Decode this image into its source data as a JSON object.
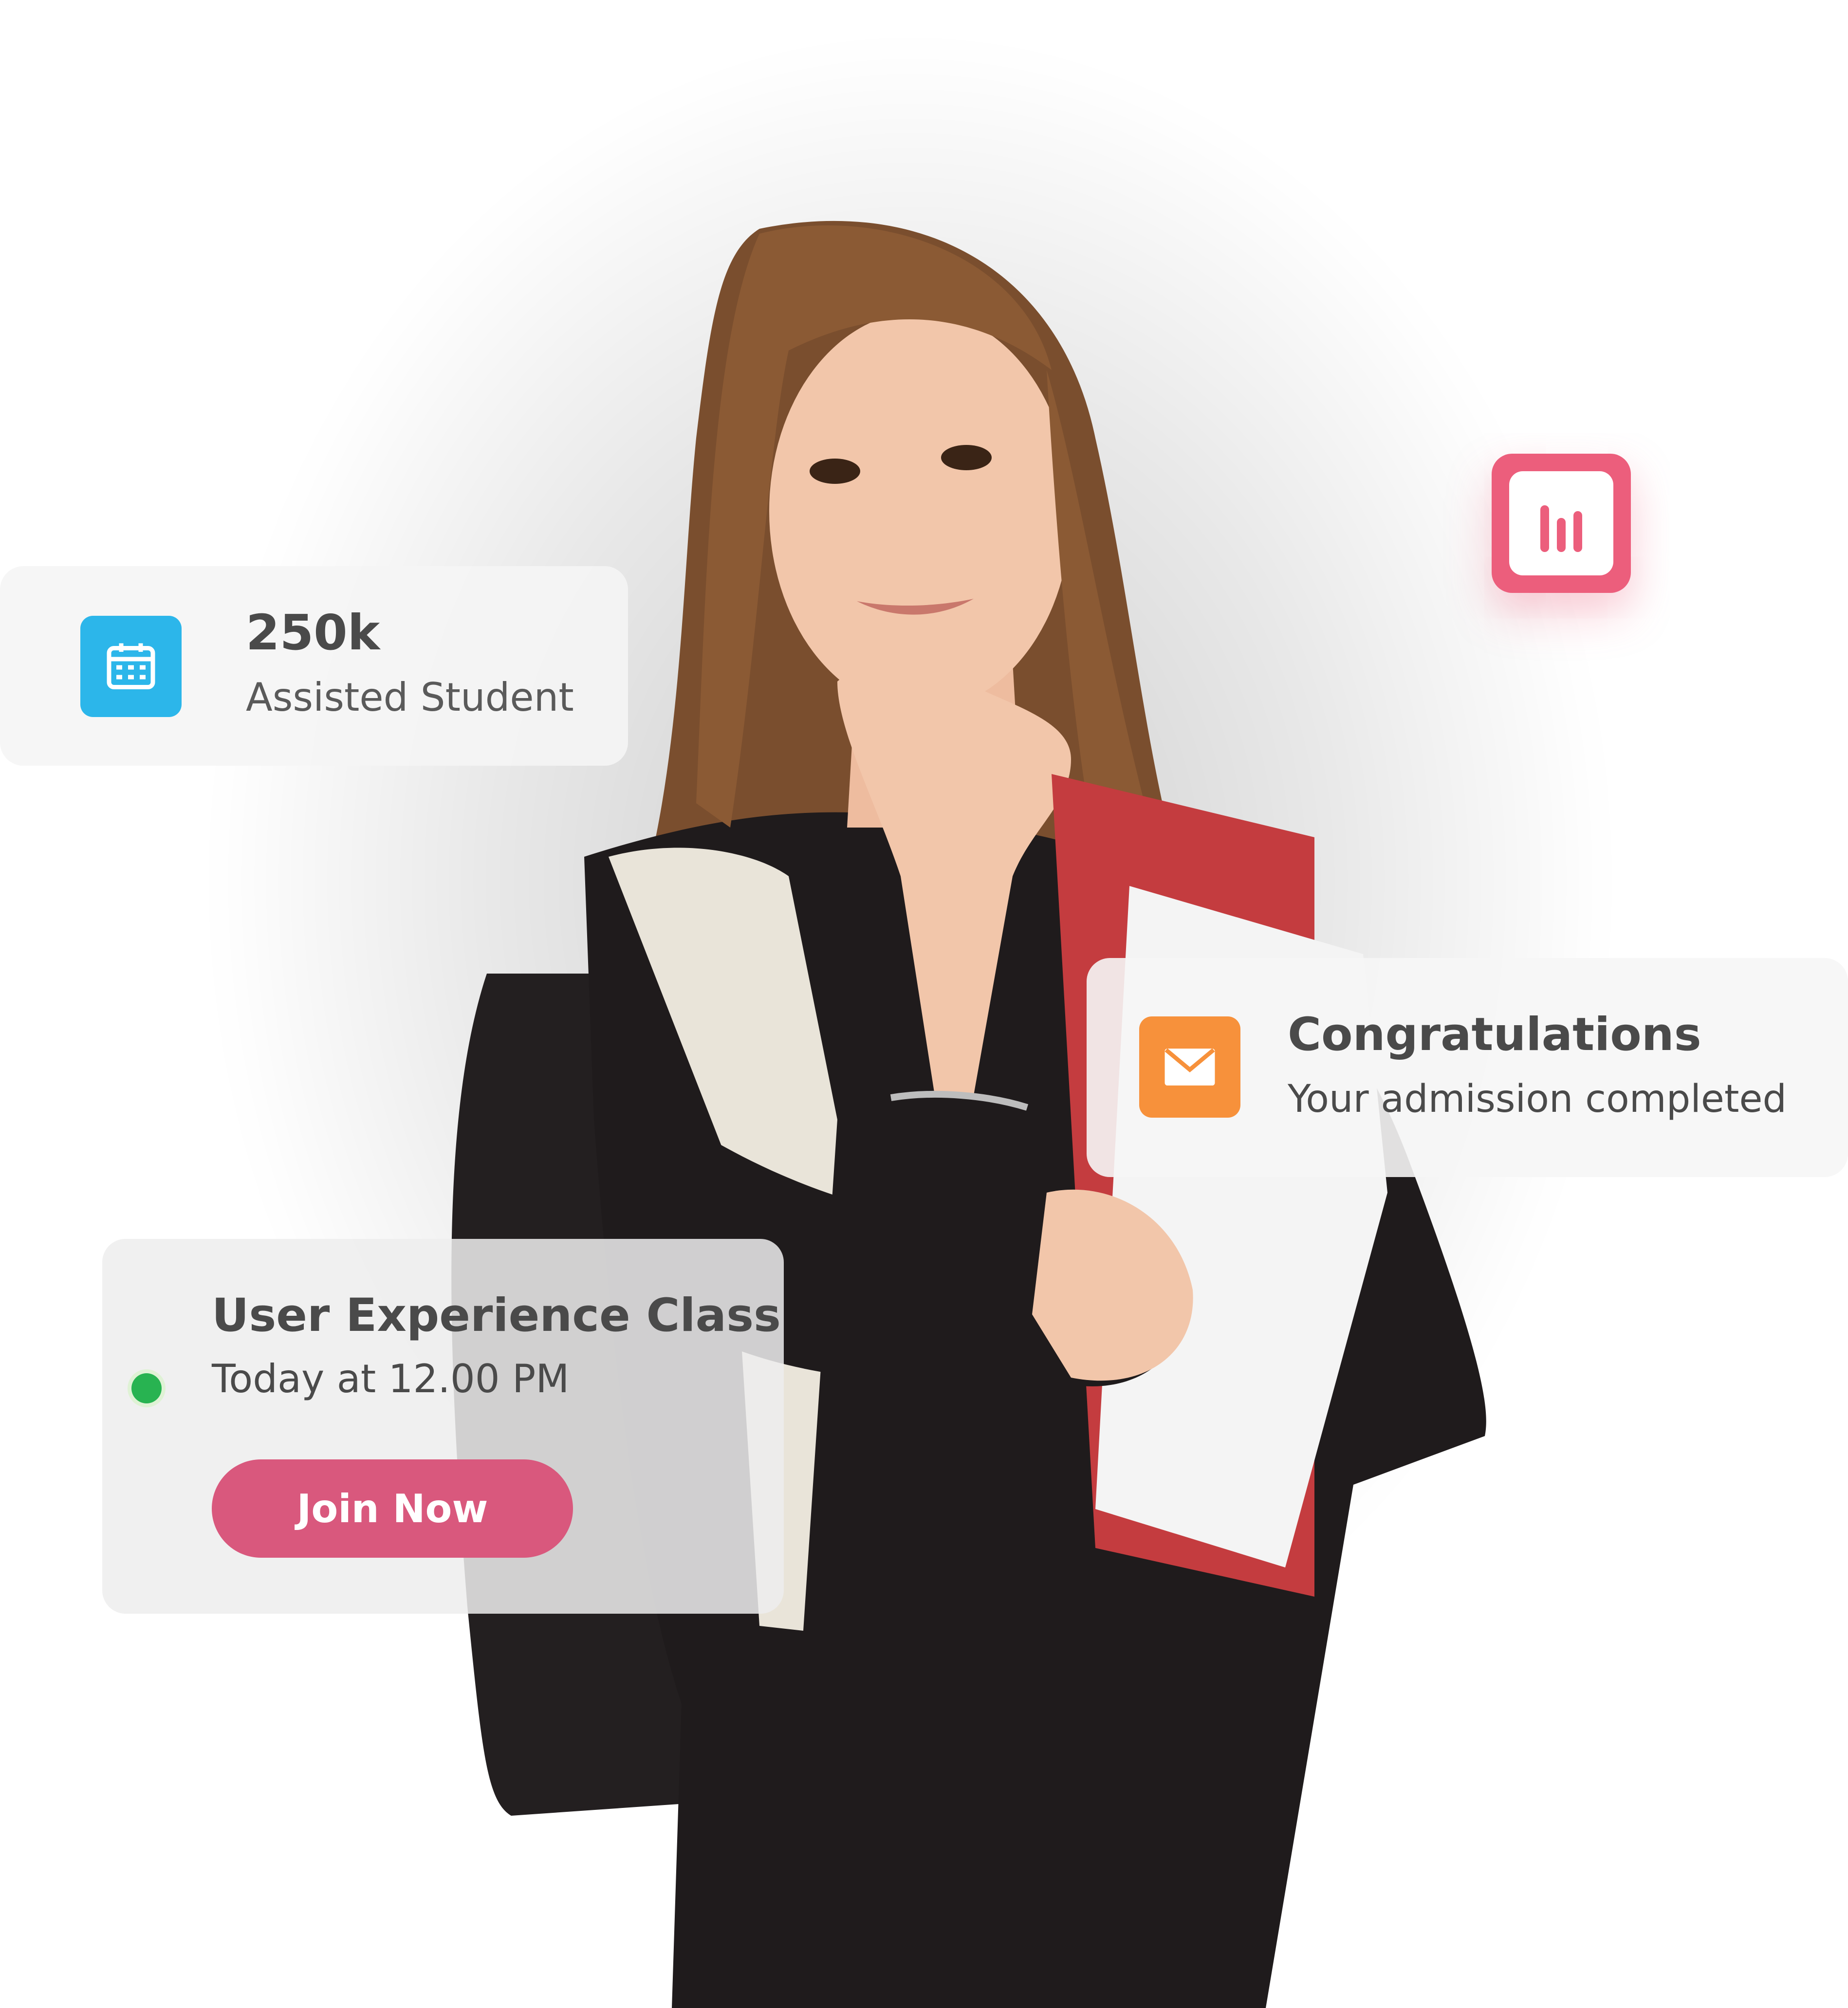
{
  "colors": {
    "calendar_icon_bg": "#2cb6ea",
    "mail_icon_bg": "#f7913b",
    "chart_icon_bg": "#ec5e7c",
    "join_button_bg": "#d9587d",
    "online_dot": "#28b351"
  },
  "stat_card": {
    "icon": "calendar-icon",
    "number": "250k",
    "label": "Assisted Student"
  },
  "chart_badge": {
    "icon": "bar-chart-icon"
  },
  "congrats_card": {
    "icon": "mail-icon",
    "title": "Congratulations",
    "subtitle": "Your admission completed"
  },
  "class_card": {
    "status_icon": "online-dot",
    "title": "User Experience Class",
    "time": "Today at 12.00 PM",
    "button_label": "Join Now"
  },
  "hero_image": {
    "subject": "student-photo"
  }
}
